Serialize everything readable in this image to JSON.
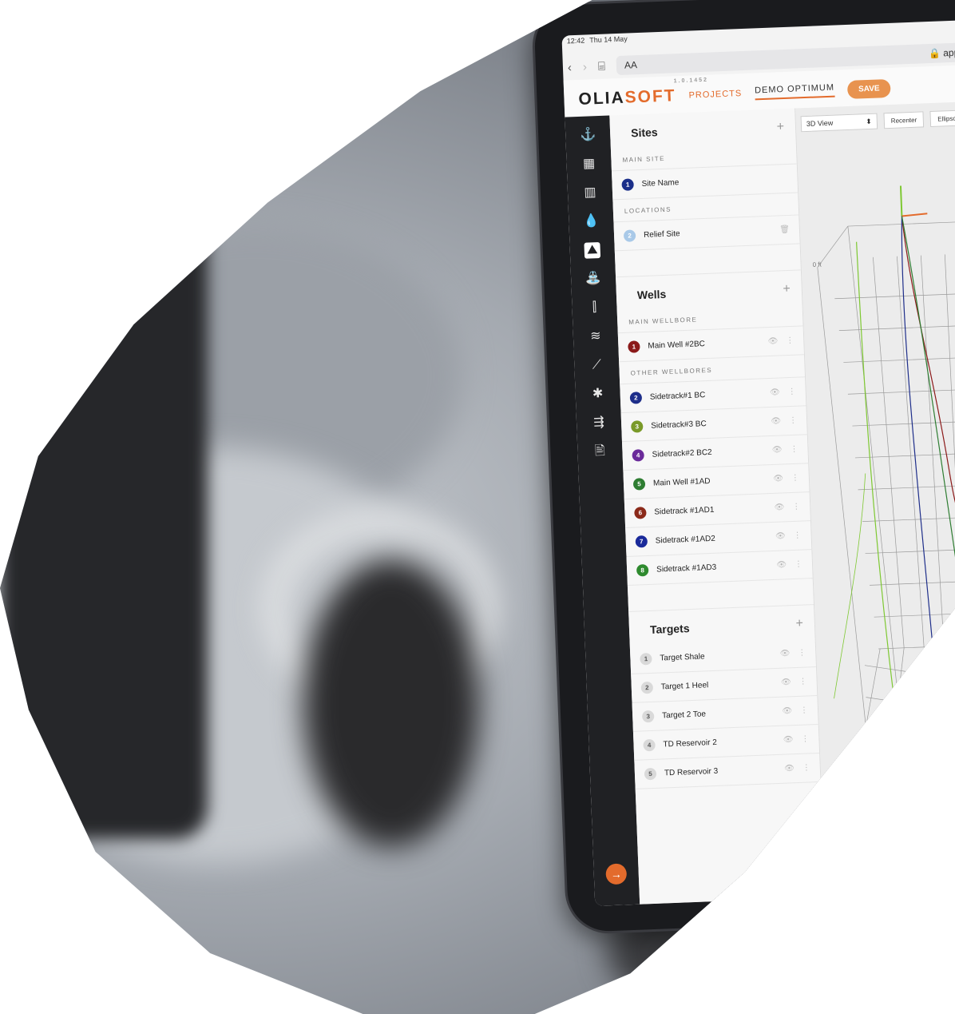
{
  "status": {
    "time": "12:42",
    "date": "Thu 14 May"
  },
  "browser": {
    "text_size": "AA",
    "url": "app.oliasoft.com"
  },
  "app": {
    "logo_left": "OLIA",
    "logo_right": "SOFT",
    "version": "1.0.1452",
    "nav_projects": "PROJECTS",
    "nav_project": "DEMO OPTIMUM",
    "save_label": "SAVE"
  },
  "sites": {
    "title": "Sites",
    "main_label": "MAIN SITE",
    "main": [
      {
        "num": "1",
        "name": "Site Name",
        "color": "#1b2f8a"
      }
    ],
    "locations_label": "LOCATIONS",
    "locations": [
      {
        "num": "2",
        "name": "Relief Site",
        "color": "#a9c9e8"
      }
    ]
  },
  "wells": {
    "title": "Wells",
    "main_label": "MAIN WELLBORE",
    "main": [
      {
        "num": "1",
        "name": "Main Well #2BC",
        "color": "#8b1a1a"
      }
    ],
    "other_label": "OTHER WELLBORES",
    "others": [
      {
        "num": "2",
        "name": "Sidetrack#1 BC",
        "color": "#1e2e8a"
      },
      {
        "num": "3",
        "name": "Sidetrack#3 BC",
        "color": "#7a9a28"
      },
      {
        "num": "4",
        "name": "Sidetrack#2 BC2",
        "color": "#6a2a9a"
      },
      {
        "num": "5",
        "name": "Main Well #1AD",
        "color": "#2e7d32"
      },
      {
        "num": "6",
        "name": "Sidetrack #1AD1",
        "color": "#8b2a1a"
      },
      {
        "num": "7",
        "name": "Sidetrack #1AD2",
        "color": "#1a2a9a"
      },
      {
        "num": "8",
        "name": "Sidetrack #1AD3",
        "color": "#2e8a2e"
      }
    ]
  },
  "targets": {
    "title": "Targets",
    "items": [
      {
        "num": "1",
        "name": "Target Shale"
      },
      {
        "num": "2",
        "name": "Target 1 Heel"
      },
      {
        "num": "3",
        "name": "Target 2 Toe"
      },
      {
        "num": "4",
        "name": "TD Reservoir 2"
      },
      {
        "num": "5",
        "name": "TD Reservoir 3"
      }
    ],
    "badge_color": "#d9d9d9"
  },
  "view": {
    "mode": "3D View",
    "recenter_label": "Recenter",
    "ellipsoid_label": "Ellipsoi",
    "depth_label": "0 ft"
  },
  "icons": {
    "rail": [
      "rig-icon",
      "grid-icon",
      "tower-icon",
      "drop-icon",
      "site-icon",
      "well-icon",
      "casing-icon",
      "chart-icon",
      "trend-icon",
      "derrick-icon",
      "survey-icon",
      "report-icon"
    ],
    "eye": "👁",
    "more": "⋮",
    "plus": "+",
    "trash": "🗑",
    "go": "→"
  },
  "colors": {
    "accent": "#e36b2c",
    "rail_bg": "#202124"
  }
}
